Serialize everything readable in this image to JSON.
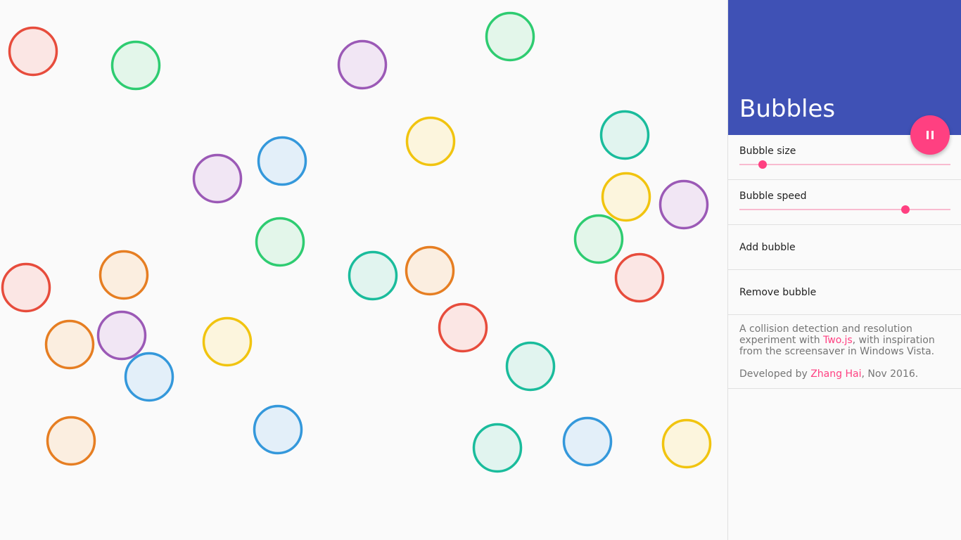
{
  "panel": {
    "title": "Bubbles",
    "pause_button": {
      "icon": "pause-icon",
      "color": "#ff4081"
    },
    "header_color": "#3f51b5",
    "controls": [
      {
        "label": "Bubble size",
        "value": 0.11
      },
      {
        "label": "Bubble speed",
        "value": 0.787
      }
    ],
    "actions": [
      {
        "label": "Add bubble"
      },
      {
        "label": "Remove bubble"
      }
    ],
    "about": {
      "line1_prefix": "A collision detection and resolution experiment with ",
      "line1_link": "Two.js",
      "line1_suffix": ", with inspiration from the screensaver in Windows Vista.",
      "line2_prefix": "Developed by ",
      "line2_link": "Zhang Hai",
      "line2_suffix": ", Nov 2016."
    }
  },
  "palette": {
    "red": {
      "stroke": "#e74c3c",
      "fill": "#fbe6e4"
    },
    "green": {
      "stroke": "#2ecc71",
      "fill": "#e3f6ea"
    },
    "purple": {
      "stroke": "#9b59b6",
      "fill": "#f1e6f4"
    },
    "blue": {
      "stroke": "#3498db",
      "fill": "#e3eff9"
    },
    "yellow": {
      "stroke": "#f1c40f",
      "fill": "#fcf5dd"
    },
    "orange": {
      "stroke": "#e67e22",
      "fill": "#fbeee0"
    },
    "teal": {
      "stroke": "#1abc9c",
      "fill": "#e1f4ef"
    }
  },
  "bubbles": [
    {
      "color": "red"
    },
    {
      "color": "green"
    },
    {
      "color": "purple"
    },
    {
      "color": "green"
    },
    {
      "color": "yellow"
    },
    {
      "color": "teal"
    },
    {
      "color": "purple"
    },
    {
      "color": "blue"
    },
    {
      "color": "yellow"
    },
    {
      "color": "purple"
    },
    {
      "color": "green"
    },
    {
      "color": "green"
    },
    {
      "color": "red"
    },
    {
      "color": "orange"
    },
    {
      "color": "teal"
    },
    {
      "color": "orange"
    },
    {
      "color": "red"
    },
    {
      "color": "red"
    },
    {
      "color": "orange"
    },
    {
      "color": "purple"
    },
    {
      "color": "yellow"
    },
    {
      "color": "blue"
    },
    {
      "color": "teal"
    },
    {
      "color": "orange"
    },
    {
      "color": "blue"
    },
    {
      "color": "teal"
    },
    {
      "color": "blue"
    },
    {
      "color": "yellow"
    }
  ]
}
